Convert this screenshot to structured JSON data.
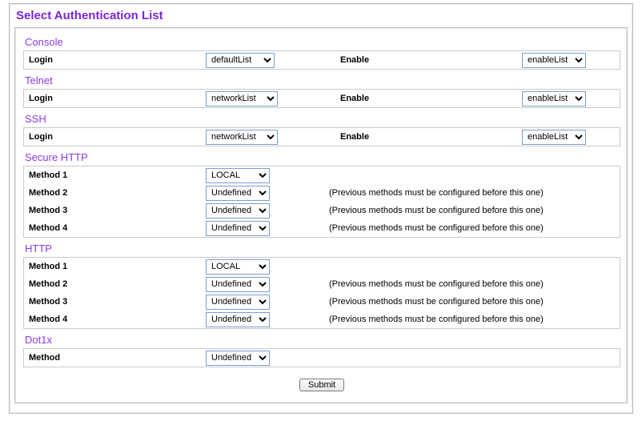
{
  "page_title": "Select Authentication List",
  "note_previous": "(Previous methods must be configured before this one)",
  "labels": {
    "login": "Login",
    "enable": "Enable",
    "method": "Method",
    "method1": "Method 1",
    "method2": "Method 2",
    "method3": "Method 3",
    "method4": "Method 4"
  },
  "sections": {
    "console": {
      "title": "Console",
      "login_value": "defaultList",
      "enable_value": "enableList"
    },
    "telnet": {
      "title": "Telnet",
      "login_value": "networkList",
      "enable_value": "enableList"
    },
    "ssh": {
      "title": "SSH",
      "login_value": "networkList",
      "enable_value": "enableList"
    },
    "https": {
      "title": "Secure HTTP",
      "m1": "LOCAL",
      "m2": "Undefined",
      "m3": "Undefined",
      "m4": "Undefined"
    },
    "http": {
      "title": "HTTP",
      "m1": "LOCAL",
      "m2": "Undefined",
      "m3": "Undefined",
      "m4": "Undefined"
    },
    "dot1x": {
      "title": "Dot1x",
      "m": "Undefined"
    }
  },
  "submit_label": "Submit"
}
